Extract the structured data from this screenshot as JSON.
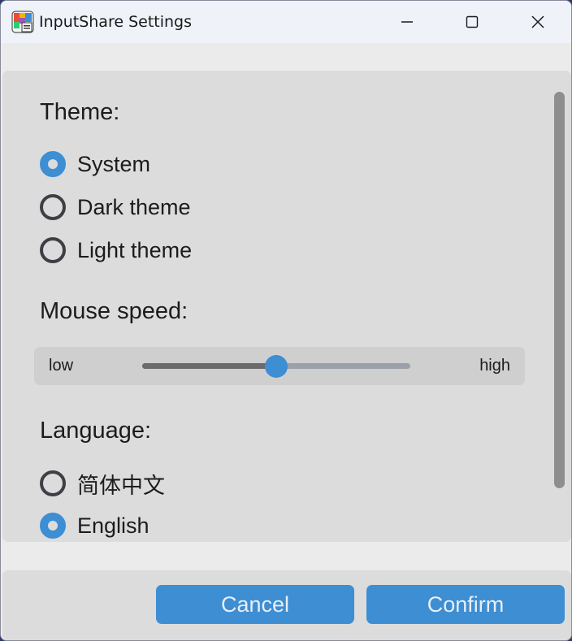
{
  "window": {
    "title": "InputShare Settings",
    "icon": "app-icon"
  },
  "theme": {
    "heading": "Theme:",
    "options": [
      {
        "label": "System",
        "checked": true
      },
      {
        "label": "Dark theme",
        "checked": false
      },
      {
        "label": "Light theme",
        "checked": false
      }
    ]
  },
  "mouse_speed": {
    "heading": "Mouse speed:",
    "low_label": "low",
    "high_label": "high",
    "level": 0.5
  },
  "language": {
    "heading": "Language:",
    "options": [
      {
        "label": "简体中文",
        "checked": false
      },
      {
        "label": "English",
        "checked": true
      }
    ]
  },
  "buttons": {
    "cancel": "Cancel",
    "confirm": "Confirm"
  },
  "colors": {
    "accent": "#3d8ed3",
    "panel": "#dcdcdc",
    "window": "#ebebeb"
  }
}
